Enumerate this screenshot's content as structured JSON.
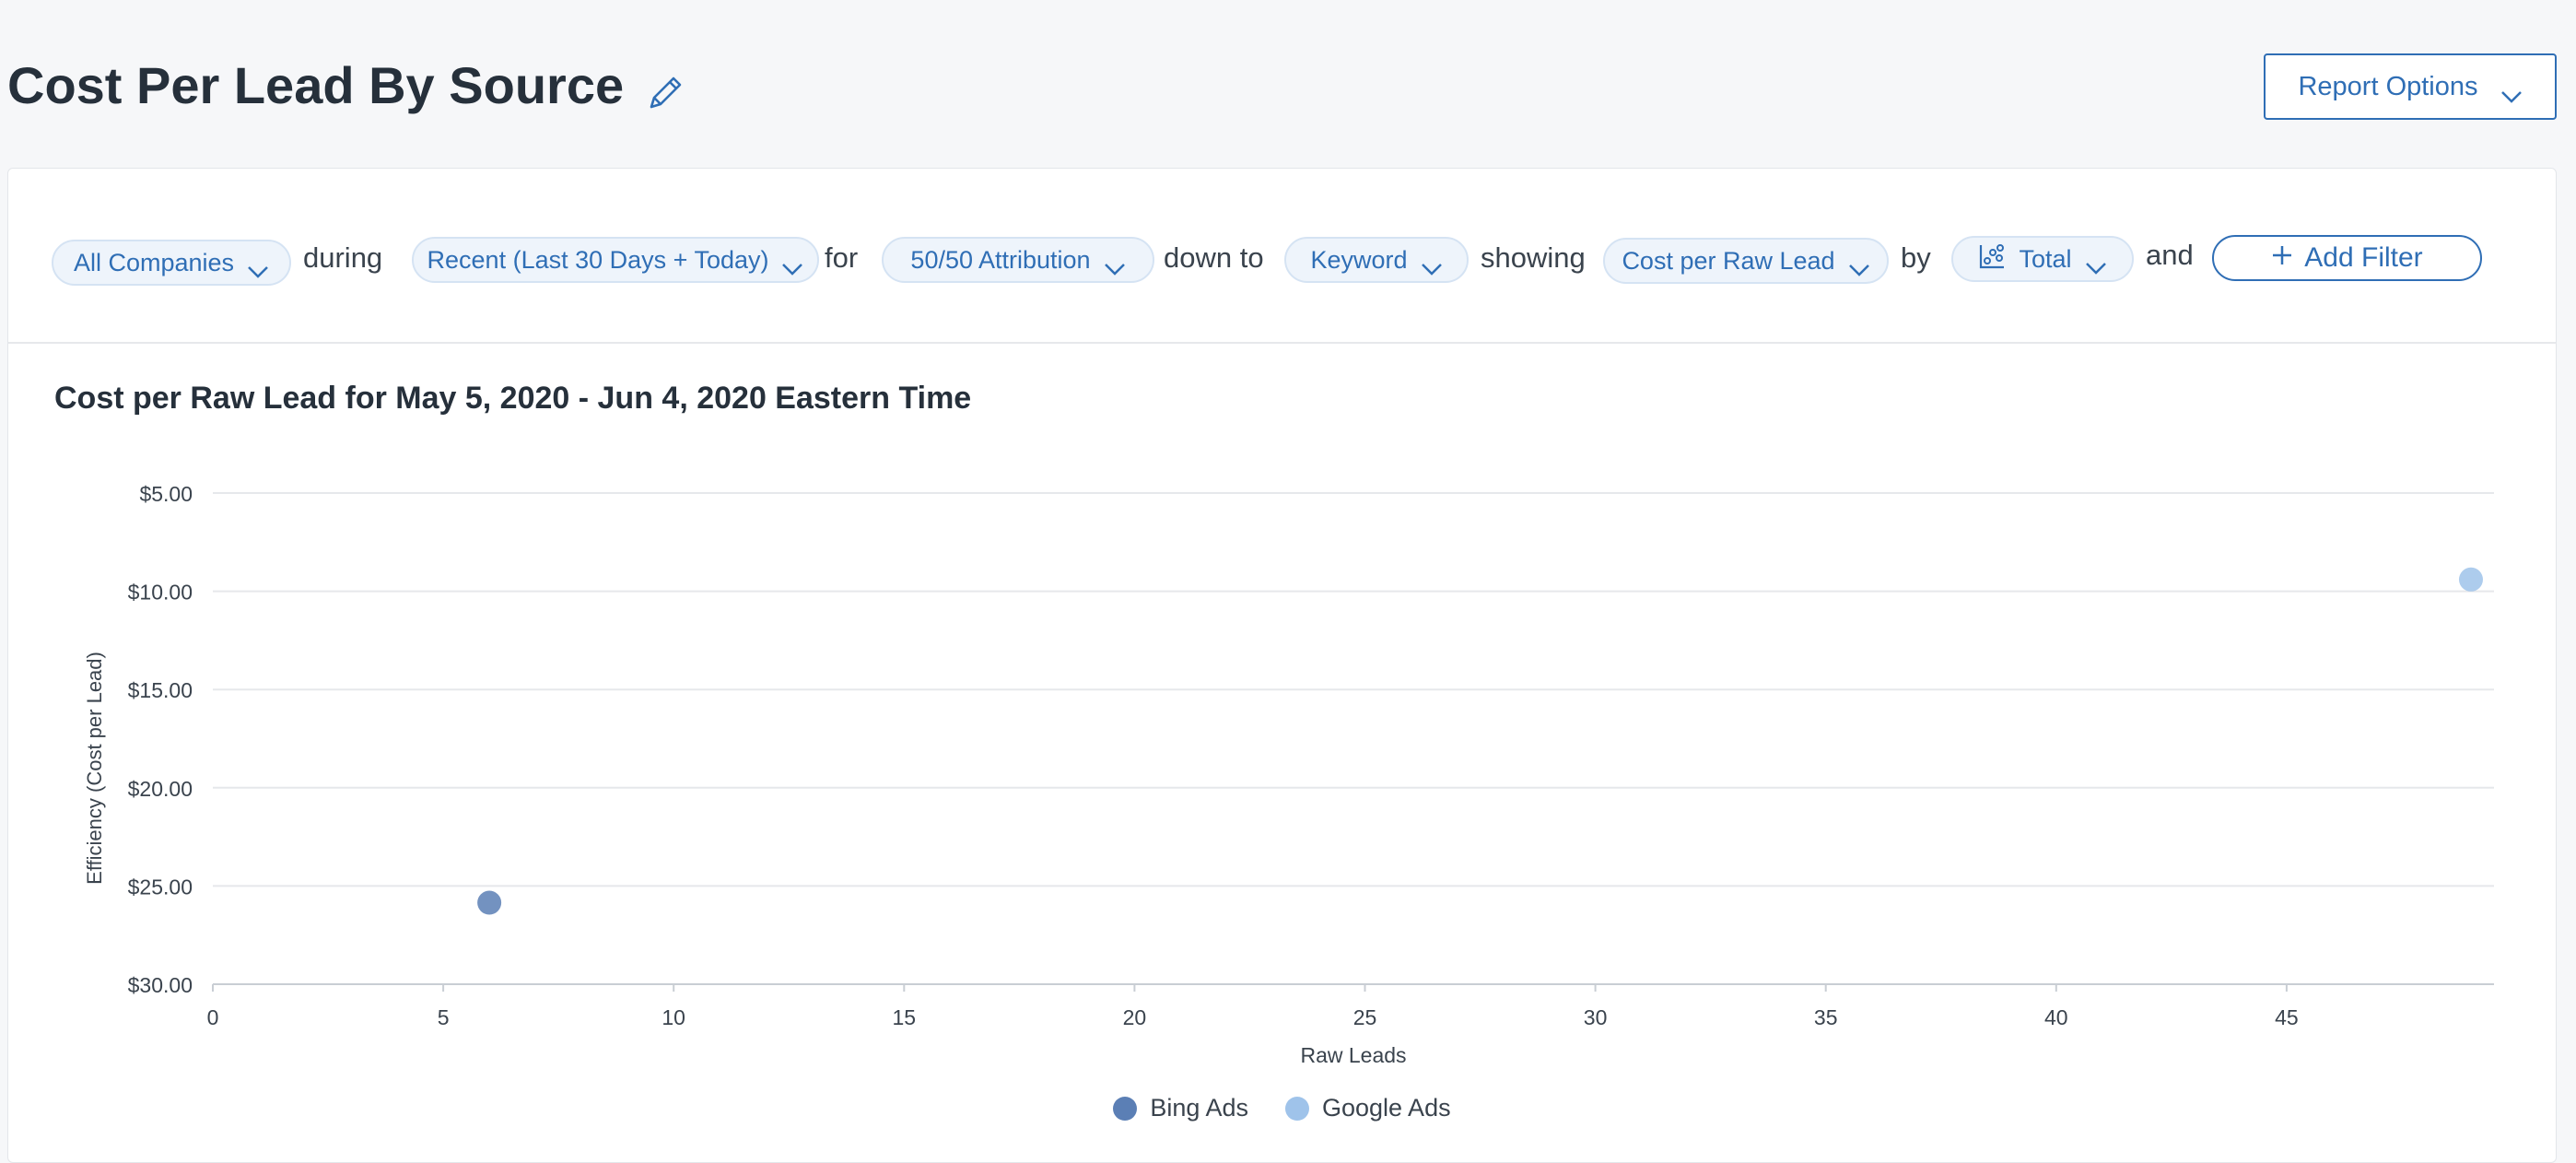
{
  "page": {
    "title": "Cost Per Lead By Source",
    "edit_icon": "pencil-icon",
    "report_options_label": "Report Options"
  },
  "filters": {
    "company": "All Companies",
    "word_during": "during",
    "date_range": "Recent (Last 30 Days + Today)",
    "word_for": "for",
    "attribution": "50/50 Attribution",
    "word_down_to": "down to",
    "level": "Keyword",
    "word_showing": "showing",
    "metric": "Cost per Raw Lead",
    "word_by": "by",
    "grouping": "Total",
    "grouping_icon": "scatter-plot-icon",
    "word_and": "and",
    "add_filter_label": "Add Filter"
  },
  "colors": {
    "accent": "#2f6eb5",
    "bing": "#5b7fb5",
    "google": "#9fc3ea",
    "grid": "#e6e8eb"
  },
  "chart_data": {
    "type": "scatter",
    "title": "Cost per Raw Lead for May 5, 2020 - Jun 4, 2020 Eastern Time",
    "xlabel": "Raw Leads",
    "ylabel": "Efficiency (Cost per Lead)",
    "xlim": [
      0,
      49.5
    ],
    "ylim": [
      5,
      30
    ],
    "y_reversed": true,
    "x_ticks": [
      "0",
      "5",
      "10",
      "15",
      "20",
      "25",
      "30",
      "35",
      "40",
      "45"
    ],
    "y_ticks": [
      "$5.00",
      "$10.00",
      "$15.00",
      "$20.00",
      "$25.00",
      "$30.00"
    ],
    "grid": true,
    "legend_position": "bottom-center",
    "series": [
      {
        "name": "Bing Ads",
        "color": "#5b7fb5",
        "points": [
          {
            "x": 6,
            "y": 25.85
          }
        ]
      },
      {
        "name": "Google Ads",
        "color": "#9fc3ea",
        "points": [
          {
            "x": 49,
            "y": 9.4
          }
        ]
      }
    ]
  }
}
